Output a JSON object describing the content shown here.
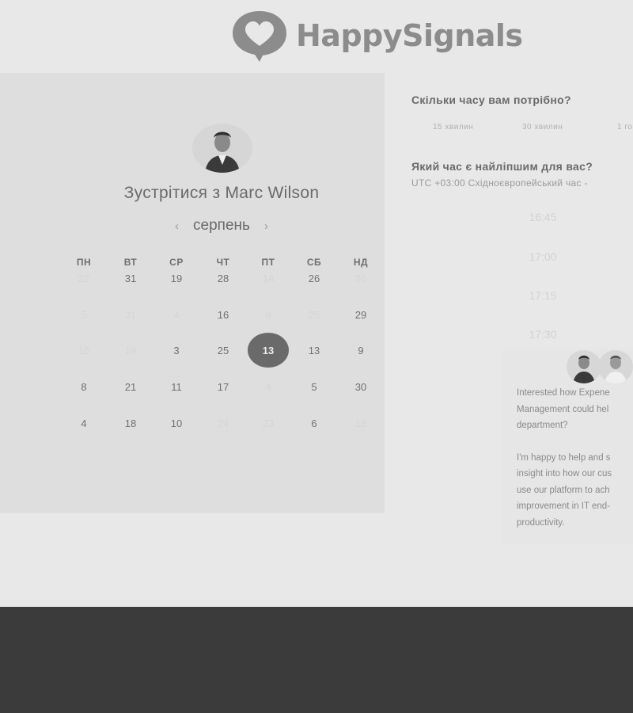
{
  "brand": {
    "name": "HappySignals",
    "logo_icon": "heart-speech-bubble-icon",
    "logo_color": "#8c8c8c"
  },
  "calendar": {
    "title": "Зустрітися з Marc Wilson",
    "month": "серпень",
    "weekdays": [
      "ПН",
      "ВТ",
      "СР",
      "ЧТ",
      "ПТ",
      "СБ",
      "НД"
    ],
    "weeks": [
      [
        {
          "d": "22",
          "m": true
        },
        {
          "d": "31"
        },
        {
          "d": "19"
        },
        {
          "d": "28"
        },
        {
          "d": "14",
          "m": true
        },
        {
          "d": "26"
        },
        {
          "d": "26",
          "m": true
        }
      ],
      [
        {
          "d": "5",
          "m": true
        },
        {
          "d": "31",
          "m": true
        },
        {
          "d": "4",
          "m": true
        },
        {
          "d": "16"
        },
        {
          "d": "6",
          "m": true
        },
        {
          "d": "25",
          "m": true
        },
        {
          "d": "29"
        }
      ],
      [
        {
          "d": "15",
          "m": true
        },
        {
          "d": "19",
          "m": true
        },
        {
          "d": "3"
        },
        {
          "d": "25"
        },
        {
          "d": "13",
          "s": true
        },
        {
          "d": "13"
        },
        {
          "d": "9"
        }
      ],
      [
        {
          "d": "8"
        },
        {
          "d": "21"
        },
        {
          "d": "11"
        },
        {
          "d": "17"
        },
        {
          "d": "4",
          "m": true
        },
        {
          "d": "5"
        },
        {
          "d": "30"
        }
      ],
      [
        {
          "d": "4"
        },
        {
          "d": "18"
        },
        {
          "d": "10"
        },
        {
          "d": "24",
          "m": true
        },
        {
          "d": "23",
          "m": true
        },
        {
          "d": "6"
        },
        {
          "d": "18",
          "m": true
        }
      ]
    ],
    "selected_color": "#6a6a6a"
  },
  "booking": {
    "duration_question": "Скільки часу вам потрібно?",
    "durations": [
      "15 хвилин",
      "30 хвилин",
      "1 го"
    ],
    "time_question": "Який час є найліпшим для вас?",
    "timezone": "UTC +03:00 Східноєвропейський час  -",
    "slots": [
      "16:45",
      "17:00",
      "17:15",
      "17:30"
    ]
  },
  "promo": {
    "lines_1": [
      "Interested how Expene",
      "Management could hel",
      "department?"
    ],
    "lines_2": [
      "I'm happy to help and s",
      "insight into how our cus",
      "use our platform to ach",
      "improvement in IT end-",
      "productivity."
    ]
  },
  "footer": {
    "color": "#3b3b3b"
  }
}
